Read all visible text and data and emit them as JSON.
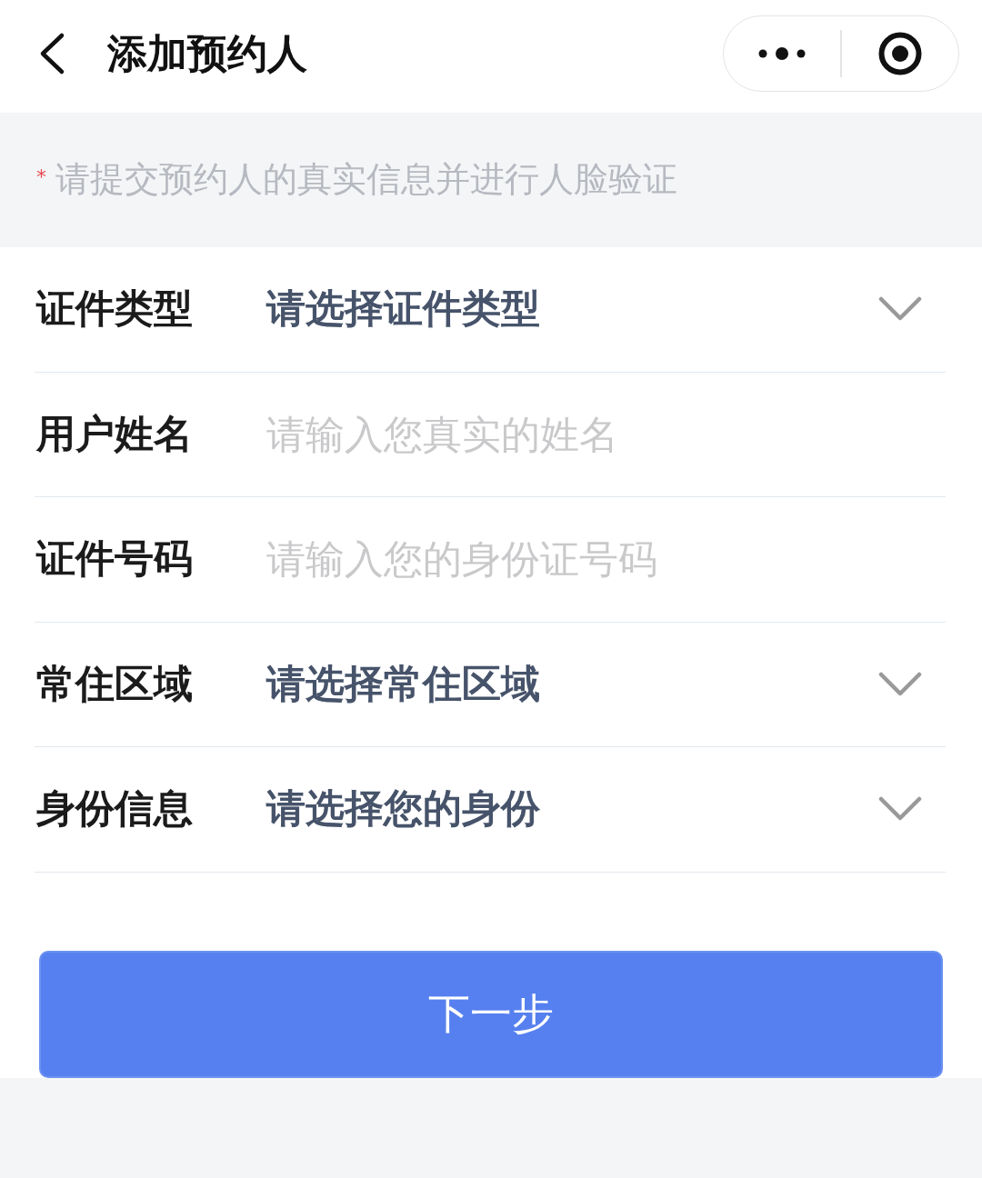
{
  "header": {
    "title": "添加预约人"
  },
  "notice": {
    "marker": "*",
    "text": "请提交预约人的真实信息并进行人脸验证"
  },
  "fields": [
    {
      "kind": "select",
      "label": "证件类型",
      "value": "请选择证件类型"
    },
    {
      "kind": "input",
      "label": "用户姓名",
      "placeholder": "请输入您真实的姓名"
    },
    {
      "kind": "input",
      "label": "证件号码",
      "placeholder": "请输入您的身份证号码"
    },
    {
      "kind": "select",
      "label": "常住区域",
      "value": "请选择常住区域"
    },
    {
      "kind": "select",
      "label": "身份信息",
      "value": "请选择您的身份"
    }
  ],
  "submit_button": {
    "label": "下一步"
  }
}
